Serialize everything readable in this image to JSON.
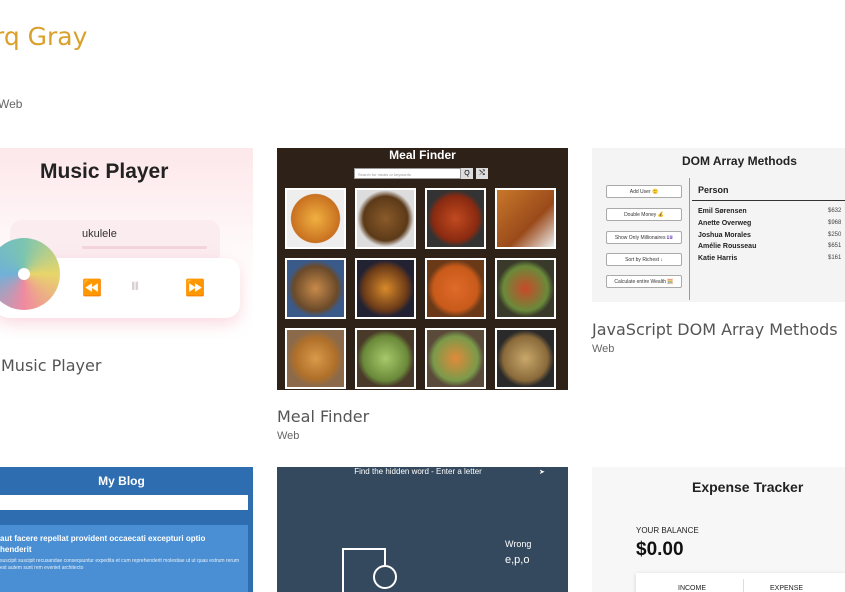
{
  "header": {
    "title": "rq Gray",
    "subtitle": "Web"
  },
  "projects": [
    {
      "title": "Music Player",
      "subtitle": "",
      "thumb": {
        "heading": "Music Player",
        "song": "ukulele"
      }
    },
    {
      "title": "Meal Finder",
      "subtitle": "Web",
      "thumb": {
        "heading": "Meal Finder",
        "search_placeholder": "Search for meals or keywords",
        "search_btn": "Q",
        "random_btn": "⤭"
      }
    },
    {
      "title": "JavaScript DOM Array Methods",
      "subtitle": "Web",
      "thumb": {
        "heading": "DOM Array Methods",
        "buttons": [
          "Add User 🙂",
          "Double Money 💰",
          "Show Only Millionaires 💷",
          "Sort by Richest ↓",
          "Calculate entire Wealth 🧮"
        ],
        "column": "Person",
        "people": [
          "Emil Sørensen",
          "Anette Overweg",
          "Joshua Morales",
          "Amélie Rousseau",
          "Katie Harris"
        ],
        "money": [
          "$632",
          "$968",
          "$250",
          "$651",
          "$161"
        ]
      }
    },
    {
      "title": "",
      "subtitle": "",
      "thumb": {
        "heading": "My Blog",
        "post_title": "aut facere repellat provident occaecati excepturi optio henderit",
        "post_body": "suscipit suscipit recusandae consequuntur expedita et cum reprehenderit molestiae ut ut quas estrum rerum est autem sunt rem eveniet architecto"
      }
    },
    {
      "title": "",
      "subtitle": "",
      "thumb": {
        "heading": "Find the hidden word - Enter a letter",
        "wrong_label": "Wrong",
        "wrong_letters": "e,p,o"
      }
    },
    {
      "title": "",
      "subtitle": "",
      "thumb": {
        "heading": "Expense Tracker",
        "balance_label": "YOUR BALANCE",
        "balance": "$0.00",
        "income_label": "INCOME",
        "expense_label": "EXPENSE"
      }
    }
  ],
  "colors": {
    "accent": "#d9a12b"
  }
}
